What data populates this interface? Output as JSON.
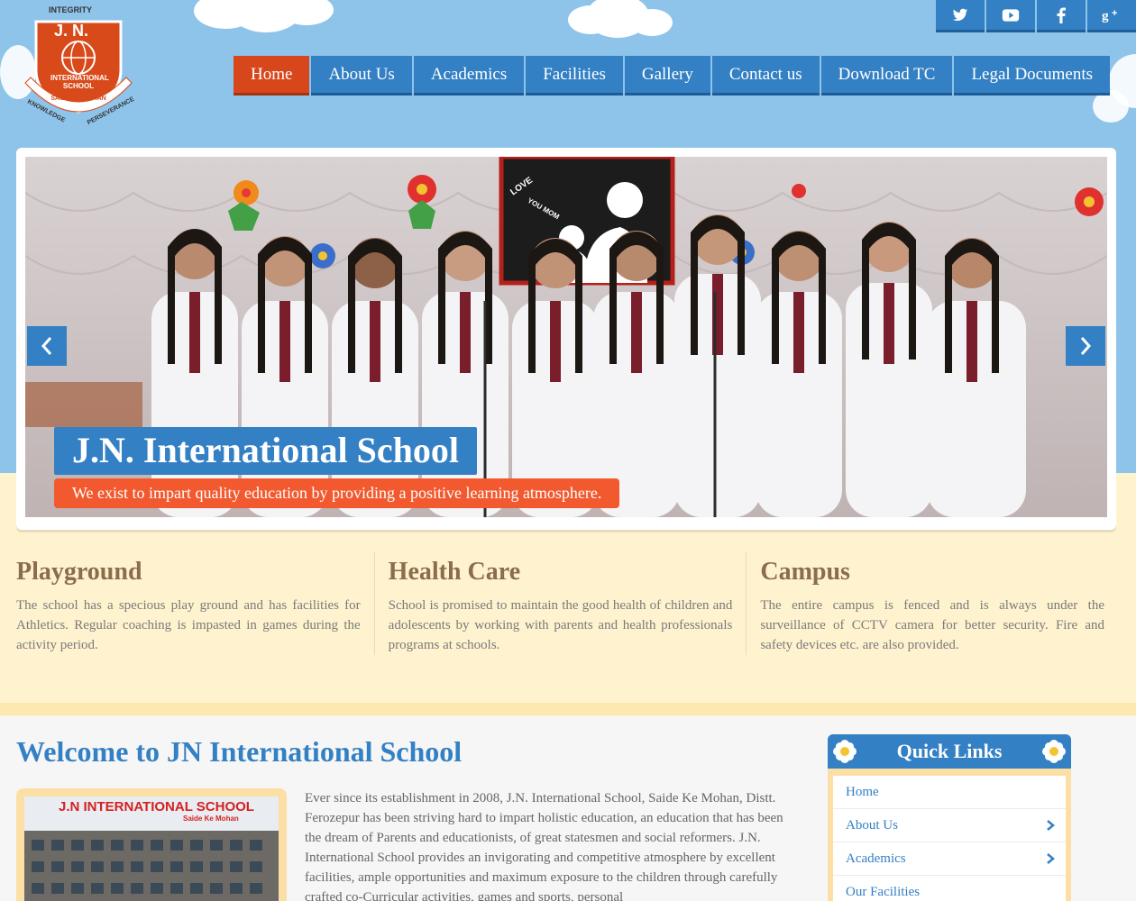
{
  "logo": {
    "top_text": "INTEGRITY",
    "initials": "J. N.",
    "school": "INTERNATIONAL SCHOOL",
    "location": "SAIDE KE MOHAN",
    "left_text": "KNOWLEDGE",
    "right_text": "PERSEVERANCE"
  },
  "social": [
    {
      "icon": "twitter-icon"
    },
    {
      "icon": "youtube-icon"
    },
    {
      "icon": "facebook-icon"
    },
    {
      "icon": "google-plus-icon"
    }
  ],
  "nav": [
    {
      "label": "Home",
      "active": true
    },
    {
      "label": "About Us"
    },
    {
      "label": "Academics"
    },
    {
      "label": "Facilities"
    },
    {
      "label": "Gallery"
    },
    {
      "label": "Contact us"
    },
    {
      "label": "Download TC"
    },
    {
      "label": "Legal Documents"
    }
  ],
  "slider": {
    "title": "J.N. International School",
    "subtitle": "We exist to impart quality education by providing a positive learning atmosphere.",
    "poster_text_1": "LOVE",
    "poster_text_2": "YOU MOM"
  },
  "features": [
    {
      "title": "Playground",
      "text": "The school has a specious play ground and has facilities for Athletics. Regular coaching is impasted in games during the activity period."
    },
    {
      "title": "Health Care",
      "text": "School is promised to maintain the good health of children and adolescents by working with parents and health professionals programs at schools."
    },
    {
      "title": "Campus",
      "text": "The entire campus is fenced and is always under the surveillance of CCTV camera for better security. Fire and safety devices etc. are also provided."
    }
  ],
  "welcome": {
    "title": "Welcome to JN International School",
    "photo_caption": "J.N INTERNATIONAL SCHOOL",
    "photo_sub": "Saide Ke Mohan",
    "text": "Ever since its establishment in 2008, J.N. International School, Saide Ke Mohan, Distt. Ferozepur has been striving hard to impart holistic education, an education that has been the dream of Parents and educationists, of great statesmen and social reformers. J.N. International School provides an invigorating and competitive atmosphere by excellent facilities, ample opportunities and maximum exposure to the children through carefully crafted co-Curricular activities, games and sports, personal"
  },
  "quick_links": {
    "title": "Quick Links",
    "items": [
      {
        "label": "Home",
        "chevron": false
      },
      {
        "label": "About Us",
        "chevron": true
      },
      {
        "label": "Academics",
        "chevron": true
      },
      {
        "label": "Our Facilities",
        "chevron": false
      }
    ]
  },
  "colors": {
    "primary_blue": "#3380c4",
    "active_orange": "#d8471c",
    "sky": "#8ec3ea",
    "cream": "#fff3cf",
    "heading_brown": "#8b6d4b"
  }
}
